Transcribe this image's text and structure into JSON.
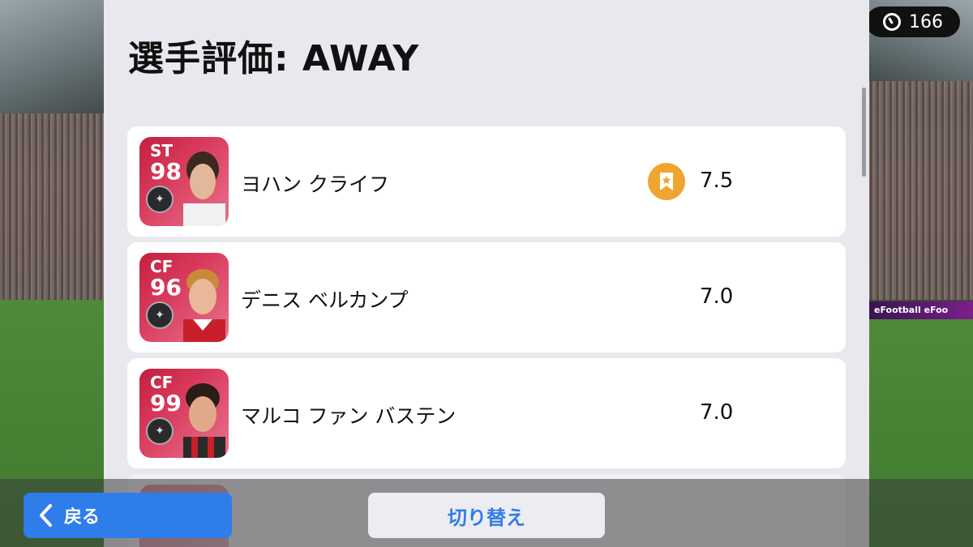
{
  "header": {
    "title": "選手評価: AWAY"
  },
  "counter": {
    "value": "166",
    "icon": "timer-icon"
  },
  "players": [
    {
      "position": "ST",
      "rating": "98",
      "name": "ヨハン クライフ",
      "score": "7.5",
      "has_medal": true,
      "card_color": "#c3203f"
    },
    {
      "position": "CF",
      "rating": "96",
      "name": "デニス ベルカンプ",
      "score": "7.0",
      "has_medal": false,
      "card_color": "#c3203f"
    },
    {
      "position": "CF",
      "rating": "99",
      "name": "マルコ ファン バステン",
      "score": "7.0",
      "has_medal": false,
      "card_color": "#c3203f"
    }
  ],
  "ad_board": "eFootball  eFoo",
  "buttons": {
    "back_label": "戻る",
    "switch_label": "切り替え"
  },
  "colors": {
    "accent": "#2f7de8",
    "medal": "#f0a531"
  }
}
